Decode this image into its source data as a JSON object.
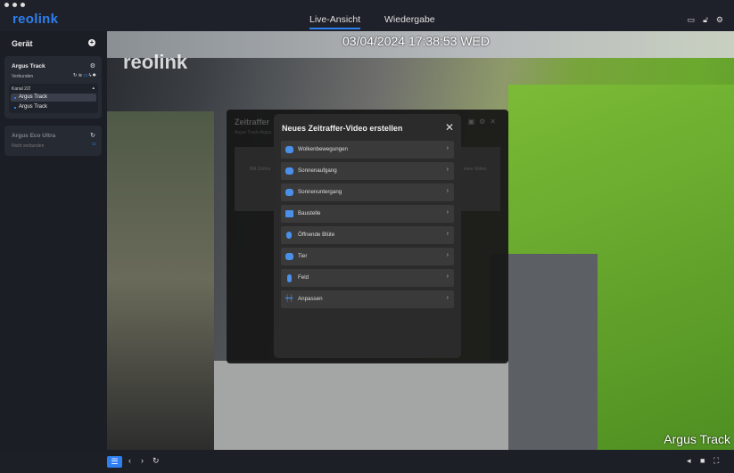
{
  "app": {
    "logo": "reolink"
  },
  "tabs": [
    {
      "label": "Live-Ansicht",
      "active": true
    },
    {
      "label": "Wiedergabe",
      "active": false
    }
  ],
  "title_icons": [
    "message-icon",
    "unlock-icon",
    "gear-icon"
  ],
  "sidebar": {
    "title": "Gerät",
    "devices": [
      {
        "name": "Argus Track",
        "status": "Verbunden",
        "channel_header": "Kanal 2/2",
        "channels": [
          "Argus Track",
          "Argus Track"
        ]
      },
      {
        "name": "Argus Eco Ultra",
        "status": "Nicht verbunden"
      }
    ]
  },
  "video": {
    "timestamp": "03/04/2024 17:38:53 WED",
    "watermark": "reolink",
    "camera_name": "Argus Track"
  },
  "background_panel": {
    "title": "Zeitraffer",
    "subtitle": "Argus Track-Argus",
    "left_card": "Mit Zeitra",
    "right_card": "ines Video"
  },
  "modal": {
    "title": "Neues Zeitraffer-Video erstellen",
    "items": [
      {
        "label": "Wolkenbewegungen",
        "icon": "cloud-icon"
      },
      {
        "label": "Sonnenaufgang",
        "icon": "sunrise-icon"
      },
      {
        "label": "Sonnenuntergang",
        "icon": "sunset-icon"
      },
      {
        "label": "Baustelle",
        "icon": "building-icon"
      },
      {
        "label": "Öffnende Blüte",
        "icon": "flower-icon"
      },
      {
        "label": "Tier",
        "icon": "paw-icon"
      },
      {
        "label": "Feld",
        "icon": "field-icon"
      },
      {
        "label": "Anpassen",
        "icon": "sliders-icon"
      }
    ]
  },
  "colors": {
    "accent": "#2f7ff0",
    "modal_bg": "#2b2b2b",
    "item_bg": "#3a3a3a"
  }
}
